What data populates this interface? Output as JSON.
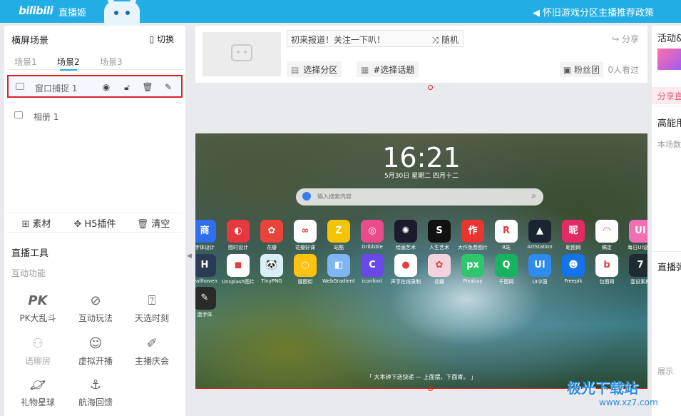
{
  "topbar": {
    "logo": "bilibili",
    "app_name": "直播姬",
    "notice": "怀旧游戏分区主播推荐政策"
  },
  "left_panel": {
    "title": "横屏场景",
    "switch_label": "切换",
    "scene_tabs": [
      "场景1",
      "场景2",
      "场景3"
    ],
    "active_scene": "场景2",
    "sources": [
      {
        "label": "窗口捕捉 1",
        "selected": true
      },
      {
        "label": "相册 1",
        "selected": false
      }
    ],
    "actions": {
      "material": "素材",
      "h5_plugin": "H5插件",
      "clear": "清空"
    },
    "tools_title": "直播工具",
    "tools_subtitle": "互动功能",
    "tools": [
      {
        "label": "PK大乱斗",
        "icon": "pk-icon"
      },
      {
        "label": "互动玩法",
        "icon": "planet-icon"
      },
      {
        "label": "天选时刻",
        "icon": "gift-box-icon"
      },
      {
        "label": "语聊房",
        "icon": "users-icon"
      },
      {
        "label": "虚拟开播",
        "icon": "avatar-icon"
      },
      {
        "label": "主播庆会",
        "icon": "party-icon"
      },
      {
        "label": "礼物星球",
        "icon": "saturn-icon"
      },
      {
        "label": "航海回馈",
        "icon": "anchor-icon"
      }
    ]
  },
  "stream_info": {
    "title_text": "初来报道！关注一下叭！",
    "random_label": "随机",
    "share_label": "分享",
    "category_label": "选择分区",
    "topic_label": "#选择话题",
    "fans_label": "粉丝团",
    "viewers": "0人看过"
  },
  "preview": {
    "clock": "16:21",
    "date": "5月30日 星期二 四月十二",
    "search_placeholder": "输入搜索内容",
    "bottom_tip": "「 大本钟下送快递 — 上面摆，下面寄。 」",
    "apps_row1": [
      {
        "name": "字体设计",
        "color": "#2f6fed",
        "glyph": "商"
      },
      {
        "name": "图时设计",
        "color": "#e6393f",
        "glyph": "◐"
      },
      {
        "name": "花瓣",
        "color": "#e8443a",
        "glyph": "✿"
      },
      {
        "name": "花瓣好课",
        "color": "#ffffff",
        "glyph": "∞"
      },
      {
        "name": "站酷",
        "color": "#f5c400",
        "glyph": "Z"
      },
      {
        "name": "Dribbble",
        "color": "#ea4c89",
        "glyph": "◎"
      },
      {
        "name": "绘画艺术",
        "color": "#1b1b2a",
        "glyph": "✺"
      },
      {
        "name": "人生艺术",
        "color": "#111111",
        "glyph": "S"
      },
      {
        "name": "大作免费图片",
        "color": "#e8362f",
        "glyph": "作"
      },
      {
        "name": "R站",
        "color": "#ffffff",
        "glyph": "R"
      },
      {
        "name": "ArtStation",
        "color": "#1b2433",
        "glyph": "▲"
      },
      {
        "name": "昵图网",
        "color": "#e22b65",
        "glyph": "昵"
      },
      {
        "name": "稿定",
        "color": "#ffffff",
        "glyph": "◠"
      },
      {
        "name": "每日UI设计",
        "color": "#f06fb5",
        "glyph": "UI"
      }
    ],
    "apps_row2": [
      {
        "name": "wallhaven",
        "color": "#2b3a55",
        "glyph": "H"
      },
      {
        "name": "Unsplash图片",
        "color": "#ffffff",
        "glyph": "◼"
      },
      {
        "name": "TinyPNG",
        "color": "#d9eef5",
        "glyph": "🐼"
      },
      {
        "name": "搜图街",
        "color": "#ffc20e",
        "glyph": "○"
      },
      {
        "name": "WebGradients",
        "color": "#7fb5f5",
        "glyph": "◧"
      },
      {
        "name": "iconfont",
        "color": "#6a47e8",
        "glyph": "C"
      },
      {
        "name": "声享在线录制",
        "color": "#ffffff",
        "glyph": "●"
      },
      {
        "name": "花瓣",
        "color": "#f3d4dd",
        "glyph": "✿"
      },
      {
        "name": "Pixabay",
        "color": "#2ec66d",
        "glyph": "px"
      },
      {
        "name": "千图网",
        "color": "#18b35f",
        "glyph": "Q"
      },
      {
        "name": "UI中国",
        "color": "#2d8cf0",
        "glyph": "UI"
      },
      {
        "name": "Freepik",
        "color": "#1273eb",
        "glyph": "☻"
      },
      {
        "name": "包图网",
        "color": "#ffffff",
        "glyph": "b"
      },
      {
        "name": "壹设素材",
        "color": "#1e2b30",
        "glyph": "7"
      }
    ],
    "apps_row3": [
      {
        "name": "造字体",
        "color": "#2a2a2a",
        "glyph": "✎"
      }
    ]
  },
  "right_panel": {
    "activity_title": "活动&",
    "share_label": "分享直",
    "high_energy_title": "高能用",
    "high_energy_sub": "本场数",
    "live_title": "直播弹",
    "show_label": "展示"
  },
  "watermark": {
    "main": "极光下载站",
    "url": "www.xz7.com"
  }
}
